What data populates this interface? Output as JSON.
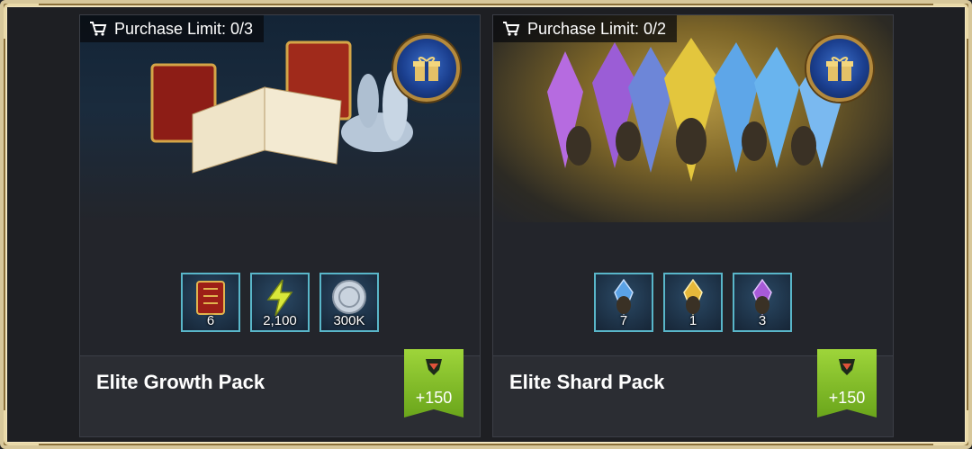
{
  "packs": [
    {
      "limit_label": "Purchase Limit: 0/3",
      "name": "Elite Growth Pack",
      "points": "+150",
      "items": [
        {
          "icon": "tome-icon",
          "qty": "6"
        },
        {
          "icon": "energy-icon",
          "qty": "2,100"
        },
        {
          "icon": "silver-coin-icon",
          "qty": "300K"
        }
      ]
    },
    {
      "limit_label": "Purchase Limit: 0/2",
      "name": "Elite Shard Pack",
      "points": "+150",
      "items": [
        {
          "icon": "ancient-shard-icon",
          "qty": "7"
        },
        {
          "icon": "sacred-shard-icon",
          "qty": "1"
        },
        {
          "icon": "void-shard-icon",
          "qty": "3"
        }
      ]
    }
  ]
}
